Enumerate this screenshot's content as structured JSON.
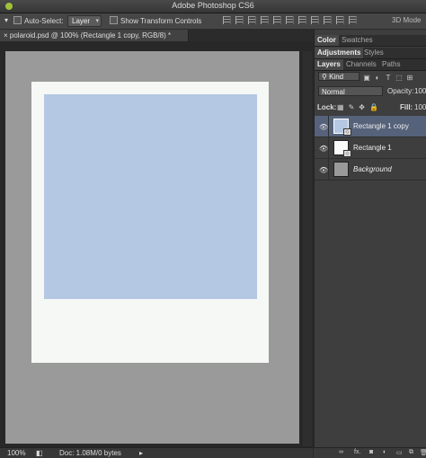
{
  "app": {
    "title": "Adobe Photoshop CS6"
  },
  "options_bar": {
    "auto_select_label": "Auto-Select:",
    "auto_select_value": "Layer",
    "transform_label": "Show Transform Controls",
    "mode_3d": "3D Mode"
  },
  "document": {
    "tab_title": "polaroid.psd @ 100% (Rectangle 1 copy, RGB/8) *"
  },
  "canvas": {
    "white_color": "#f6f8f6",
    "photo_color": "#b4c8e3"
  },
  "status": {
    "zoom": "100%",
    "doc_info": "Doc: 1.08M/0 bytes"
  },
  "panels": {
    "group1_tabs": [
      "Color",
      "Swatches"
    ],
    "group2_tabs": [
      "Adjustments",
      "Styles"
    ],
    "group3_tabs": [
      "Layers",
      "Channels",
      "Paths"
    ]
  },
  "layers_panel": {
    "filter_kind": "Kind",
    "blend_mode": "Normal",
    "opacity_label": "Opacity:",
    "opacity_value": "100",
    "lock_label": "Lock:",
    "fill_label": "Fill:",
    "fill_value": "100",
    "layers": [
      {
        "name": "Rectangle 1 copy",
        "selected": true
      },
      {
        "name": "Rectangle 1",
        "selected": false
      },
      {
        "name": "Background",
        "selected": false
      }
    ]
  },
  "bottom_bar": {
    "link": "∞",
    "fx": "fx."
  }
}
